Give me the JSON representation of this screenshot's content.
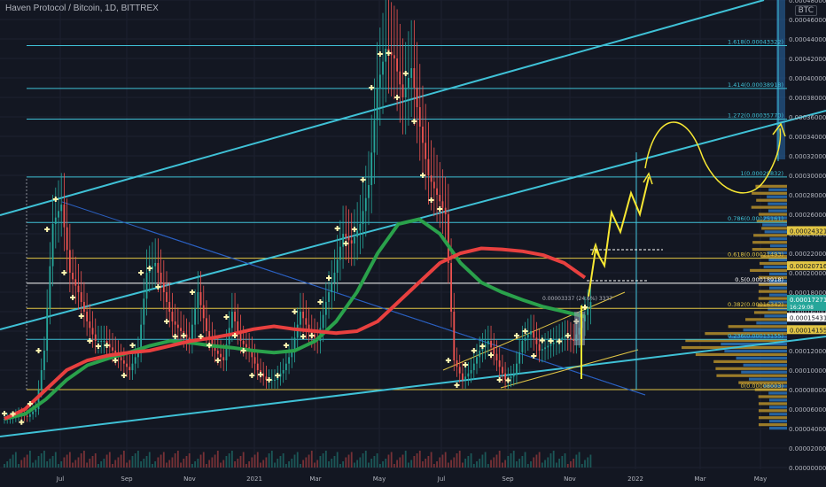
{
  "header": {
    "title": "Haven Protocol / Bitcoin, 1D, BITTREX",
    "currency": "BTC"
  },
  "colors": {
    "bg": "#131722",
    "grid": "#1c2030",
    "cyan": "#3fc1d6",
    "yellow": "#e2c645",
    "ma_red": "#e8403f",
    "ma_green": "#2aa14b",
    "candle_up": "#26a69a",
    "candle_down": "#ef5350",
    "axis_text": "#b2b5be",
    "label_dark": "#131722",
    "vp_blue": "#2a71b6",
    "vp_yellow": "#b58e2a"
  },
  "chart_data": {
    "type": "line",
    "x_ticks": [
      "Jul",
      "Sep",
      "Nov",
      "2021",
      "Mar",
      "May",
      "Jul",
      "Sep",
      "Nov",
      "2022",
      "Mar",
      "May"
    ],
    "y_ticks": [
      "0.00048000",
      "0.00046000",
      "0.00044000",
      "0.00042000",
      "0.00040000",
      "0.00038000",
      "0.00036000",
      "0.00034000",
      "0.00032000",
      "0.00030000",
      "0.00028000",
      "0.00026000",
      "0.00024000",
      "0.00022000",
      "0.00020000",
      "0.00018000",
      "0.00016000",
      "0.00014000",
      "0.00012000",
      "0.00010000",
      "0.00008000",
      "0.00006000",
      "0.00004000",
      "0.00002000",
      "0.00000000"
    ],
    "ylim": [
      0,
      0.0005
    ],
    "fib_levels": [
      {
        "label": "1.618(0.00043322)",
        "value": 0.00043322,
        "color": "#3fc1d6"
      },
      {
        "label": "1.414(0.00038918)",
        "value": 0.00038918,
        "color": "#3fc1d6"
      },
      {
        "label": "1.272(0.00035770)",
        "value": 0.0003577,
        "color": "#3fc1d6"
      },
      {
        "label": "1(0.00029832)",
        "value": 0.00029832,
        "color": "#3fc1d6"
      },
      {
        "label": "0.786(0.00025161)",
        "value": 0.00025161,
        "color": "#3fc1d6"
      },
      {
        "label": "0.618(0.00021493)",
        "value": 0.00021493,
        "color": "#e2c645"
      },
      {
        "label": "0.5(0.00018918)",
        "value": 0.00018918,
        "color": "#ffffff"
      },
      {
        "label": "0.382(0.00016342)",
        "value": 0.00016342,
        "color": "#e2c645"
      },
      {
        "label": "0.236(0.00013155)",
        "value": 0.00013155,
        "color": "#3fc1d6"
      },
      {
        "label": "0(0.00008003)",
        "value": 8.003e-05,
        "color": "#e2c645"
      }
    ],
    "price_labels": [
      {
        "text": "0.00024321",
        "value": 0.00024321,
        "bg": "#e2c645",
        "fg": "#131722"
      },
      {
        "text": "0.00020716",
        "value": 0.00020716,
        "bg": "#e2c645",
        "fg": "#131722"
      },
      {
        "text": "0.00017271",
        "value": 0.00017271,
        "bg": "#26a69a",
        "fg": "#ffffff",
        "sub": "16:29:08"
      },
      {
        "text": "0.00015431",
        "value": 0.00015431,
        "bg": "#ffffff",
        "fg": "#131722"
      },
      {
        "text": "0.00014155",
        "value": 0.00014155,
        "bg": "#e2c645",
        "fg": "#131722"
      }
    ],
    "annotation": "0.00003337 (24.6%) 3337",
    "price_series": [
      5e-05,
      5.5e-05,
      5.2e-05,
      6e-05,
      0.00012,
      0.00025,
      0.00027,
      0.0002,
      0.00018,
      0.00015,
      0.00013,
      0.00013,
      0.00012,
      0.00011,
      0.0001,
      0.00012,
      0.0002,
      0.00021,
      0.00018,
      0.00015,
      0.00014,
      0.00013,
      0.00018,
      0.00014,
      0.00012,
      0.00011,
      0.00016,
      0.00013,
      0.00012,
      0.0001,
      9e-05,
      9e-05,
      0.0001,
      0.00012,
      0.00016,
      0.00014,
      0.00013,
      0.00017,
      0.0002,
      0.00024,
      0.00023,
      0.00025,
      0.00029,
      0.00039,
      0.00043,
      0.00042,
      0.00038,
      0.00041,
      0.00035,
      0.0003,
      0.00028,
      0.00026,
      0.00011,
      9e-05,
      0.0001,
      0.00012,
      0.00013,
      0.00011,
      9e-05,
      9.5e-05,
      0.00013,
      0.00014,
      0.00012,
      0.000125,
      0.00013,
      0.000135,
      0.00013,
      0.00015,
      0.00017
    ],
    "ma_red": [
      5e-05,
      6e-05,
      8e-05,
      0.0001,
      0.00011,
      0.000115,
      0.000118,
      0.00012,
      0.000125,
      0.00013,
      0.000133,
      0.000137,
      0.000142,
      0.000145,
      0.000142,
      0.00014,
      0.000138,
      0.00014,
      0.00015,
      0.00017,
      0.00019,
      0.00021,
      0.00022,
      0.000225,
      0.000224,
      0.000222,
      0.000218,
      0.00021,
      0.000195
    ],
    "ma_green": [
      5e-05,
      5.5e-05,
      7e-05,
      9e-05,
      0.000105,
      0.000112,
      0.000118,
      0.000125,
      0.00013,
      0.000128,
      0.000125,
      0.000123,
      0.00012,
      0.000118,
      0.00012,
      0.00013,
      0.00015,
      0.00018,
      0.00022,
      0.00025,
      0.000255,
      0.00024,
      0.00021,
      0.00019,
      0.00018,
      0.000172,
      0.000165,
      0.00016,
      0.000155
    ]
  }
}
